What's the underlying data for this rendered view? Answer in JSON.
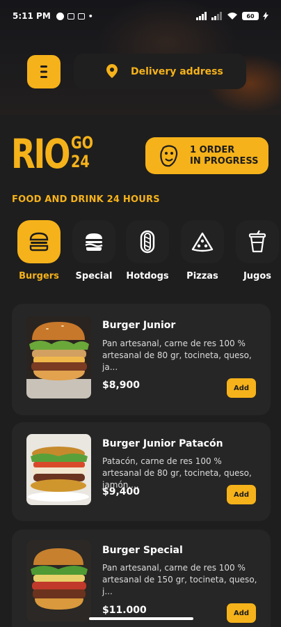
{
  "status_bar": {
    "time": "5:11 PM",
    "battery": "60"
  },
  "header": {
    "menu_icon": "menu-icon",
    "address_label": "Delivery address"
  },
  "brand": {
    "name_main": "RIO",
    "name_top": "GO",
    "name_bottom": "24",
    "tagline": "FOOD AND DRINK 24 HOURS"
  },
  "order_status": {
    "line1": "1 ORDER",
    "line2": "IN PROGRESS"
  },
  "categories": [
    {
      "label": "Burgers",
      "icon": "burger-icon",
      "active": true
    },
    {
      "label": "Special",
      "icon": "special-burger-icon",
      "active": false
    },
    {
      "label": "Hotdogs",
      "icon": "hotdog-icon",
      "active": false
    },
    {
      "label": "Pizzas",
      "icon": "pizza-icon",
      "active": false
    },
    {
      "label": "Jugos",
      "icon": "juice-icon",
      "active": false
    }
  ],
  "products": [
    {
      "name": "Burger Junior",
      "description": "Pan artesanal, carne de res 100 % artesanal de 80 gr, tocineta, queso, ja...",
      "price": "$8,900",
      "add_label": "Add"
    },
    {
      "name": "Burger Junior Patacón",
      "description": "Patacón, carne de res 100 % artesanal de 80 gr, tocineta, queso, jamón,...",
      "price": "$9,400",
      "add_label": "Add"
    },
    {
      "name": "Burger Special",
      "description": "Pan artesanal, carne de res 100 % artesanal de 150 gr, tocineta, queso, j...",
      "price": "$11.000",
      "add_label": "Add"
    }
  ],
  "colors": {
    "accent": "#f5b21a",
    "background": "#1e1e1e",
    "card": "#262626"
  }
}
